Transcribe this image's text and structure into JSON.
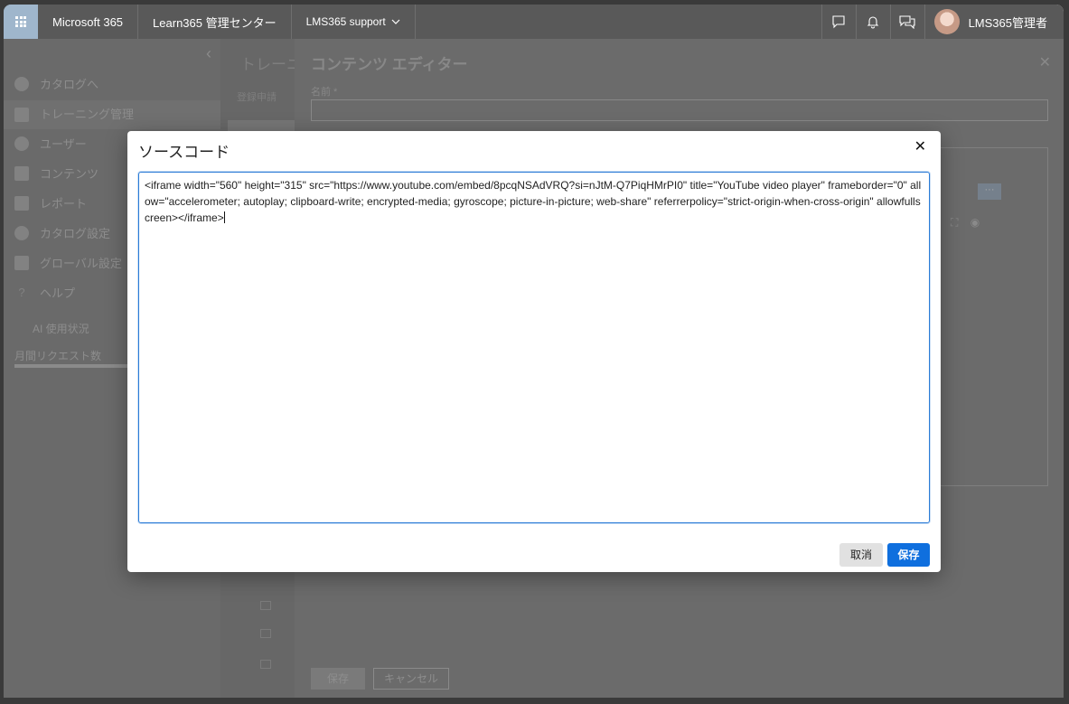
{
  "topbar": {
    "app_name": "Microsoft 365",
    "admin_center": "Learn365 管理センター",
    "tenant": "LMS365 support",
    "user_name": "LMS365管理者",
    "icons": [
      "app-launcher-icon",
      "chat-icon",
      "bell-icon",
      "feedback-icon"
    ]
  },
  "sidebar": {
    "items": [
      {
        "label": "カタログへ",
        "icon": "check-circle-icon"
      },
      {
        "label": "トレーニング管理",
        "icon": "grid-icon"
      },
      {
        "label": "ユーザー",
        "icon": "user-icon"
      },
      {
        "label": "コンテンツ",
        "icon": "folder-icon"
      },
      {
        "label": "レポート",
        "icon": "chart-icon"
      },
      {
        "label": "カタログ設定",
        "icon": "gear-icon"
      },
      {
        "label": "グローバル設定",
        "icon": "office-icon"
      },
      {
        "label": "ヘルプ",
        "icon": "question-icon"
      }
    ],
    "ai_usage": "AI 使用状況",
    "monthly_requests": "月間リクエスト数"
  },
  "midpage": {
    "title": "トレーニ",
    "subtitle": "登録申請"
  },
  "editor": {
    "title": "コンテンツ エディター",
    "name_label": "名前 *",
    "more_label": "···",
    "save_label": "保存",
    "cancel_label": "キャンセル"
  },
  "modal": {
    "title": "ソースコード",
    "close_label": "✕",
    "code": "<iframe width=\"560\" height=\"315\" src=\"https://www.youtube.com/embed/8pcqNSAdVRQ?si=nJtM-Q7PiqHMrPI0\" title=\"YouTube video player\" frameborder=\"0\" allow=\"accelerometer; autoplay; clipboard-write; encrypted-media; gyroscope; picture-in-picture; web-share\" referrerpolicy=\"strict-origin-when-cross-origin\" allowfullscreen></iframe>",
    "cancel_label": "取消",
    "save_label": "保存"
  },
  "colors": {
    "primary": "#0f6fde",
    "topbar": "#595959",
    "overlay": "#6b6b6b"
  }
}
